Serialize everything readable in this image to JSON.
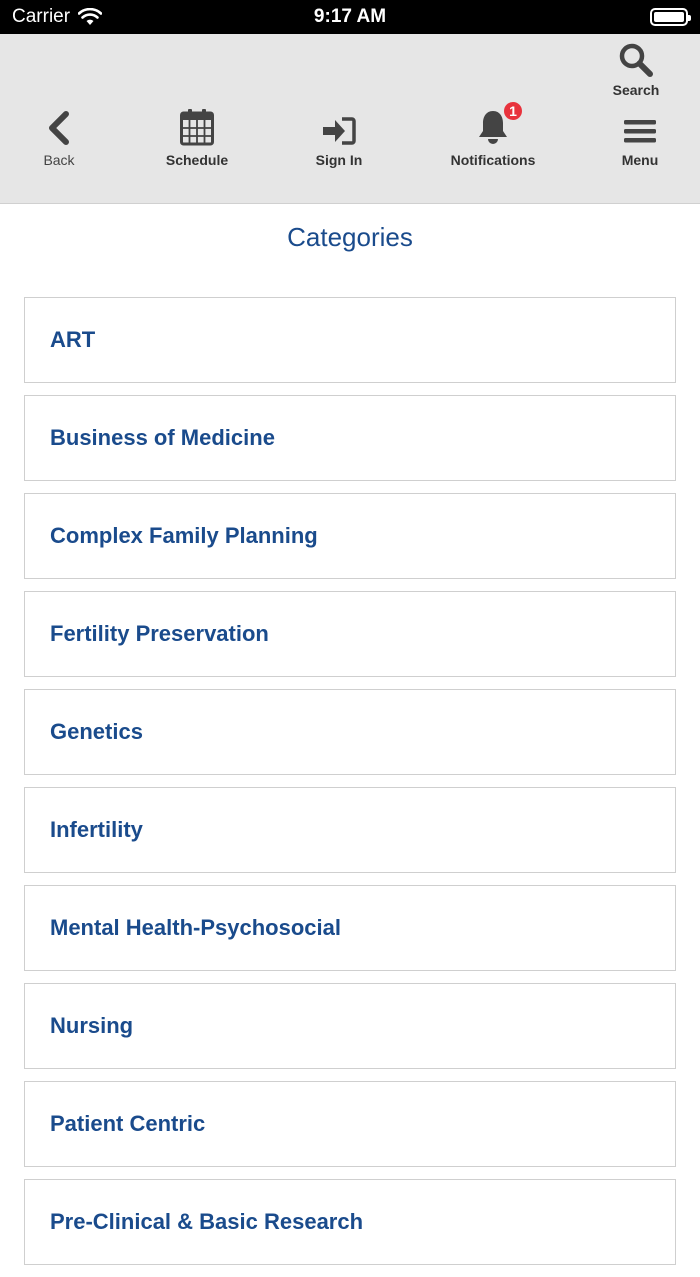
{
  "status_bar": {
    "carrier": "Carrier",
    "time": "9:17 AM"
  },
  "toolbar": {
    "search_label": "Search",
    "back_label": "Back",
    "schedule_label": "Schedule",
    "signin_label": "Sign In",
    "notifications_label": "Notifications",
    "notifications_badge": "1",
    "menu_label": "Menu"
  },
  "page": {
    "title": "Categories"
  },
  "categories": [
    {
      "label": "ART"
    },
    {
      "label": "Business of Medicine"
    },
    {
      "label": "Complex Family Planning"
    },
    {
      "label": "Fertility Preservation"
    },
    {
      "label": "Genetics"
    },
    {
      "label": "Infertility"
    },
    {
      "label": "Mental Health-Psychosocial"
    },
    {
      "label": "Nursing"
    },
    {
      "label": "Patient Centric"
    },
    {
      "label": "Pre-Clinical & Basic Research"
    }
  ],
  "colors": {
    "accent": "#1a4b8c",
    "toolbar_bg": "#e6e6e6",
    "badge": "#e8323c"
  },
  "icons": [
    "wifi-icon",
    "battery-icon",
    "search-icon",
    "back-chevron-icon",
    "calendar-icon",
    "sign-in-icon",
    "bell-icon",
    "hamburger-menu-icon"
  ]
}
